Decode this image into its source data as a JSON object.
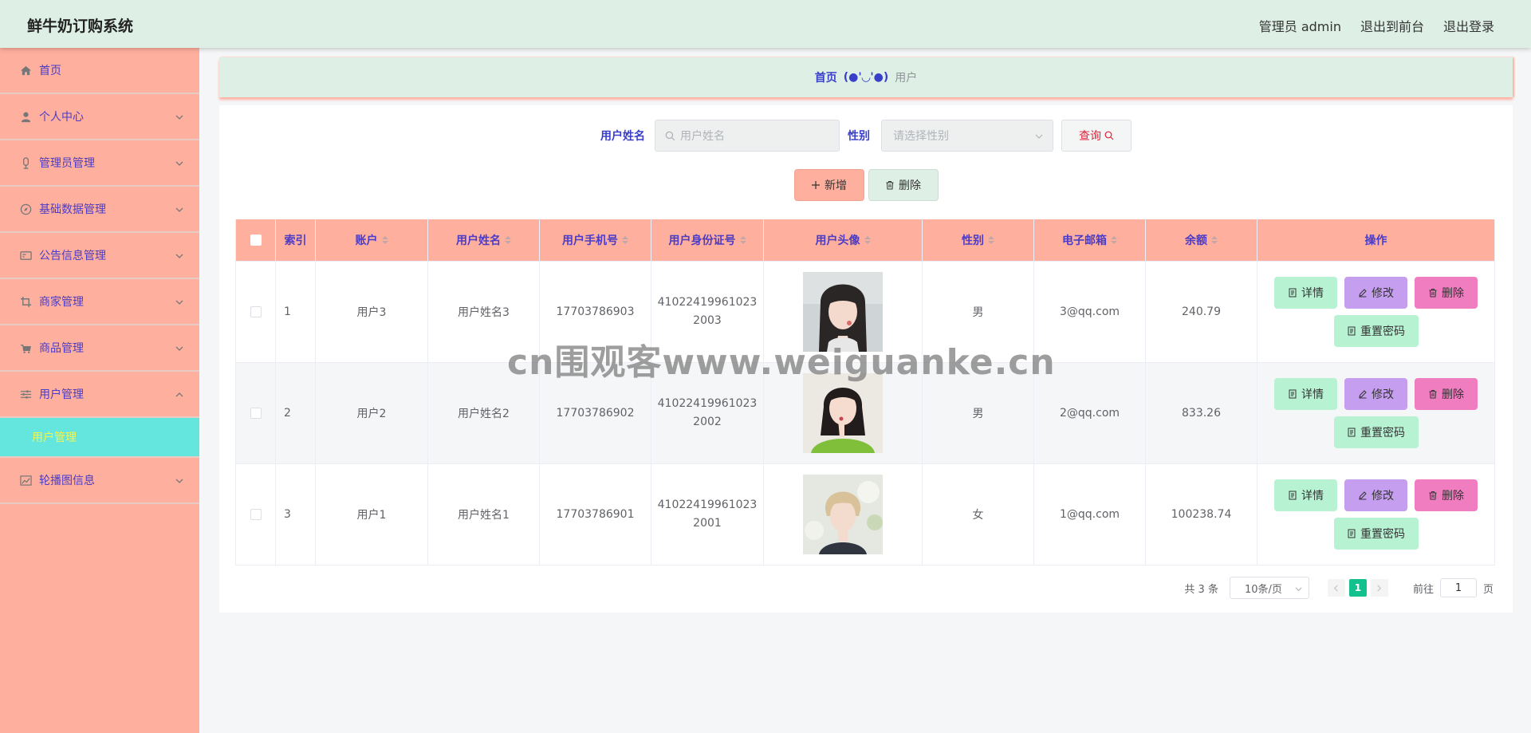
{
  "app": {
    "title": "鲜牛奶订购系统"
  },
  "header": {
    "user_label": "管理员 admin",
    "to_front": "退出到前台",
    "logout": "退出登录"
  },
  "sidebar": {
    "items": [
      {
        "label": "首页",
        "icon": "home-icon"
      },
      {
        "label": "个人中心",
        "icon": "user-icon"
      },
      {
        "label": "管理员管理",
        "icon": "admin-icon"
      },
      {
        "label": "基础数据管理",
        "icon": "compass-icon"
      },
      {
        "label": "公告信息管理",
        "icon": "card-icon"
      },
      {
        "label": "商家管理",
        "icon": "crop-icon"
      },
      {
        "label": "商品管理",
        "icon": "cart-icon"
      },
      {
        "label": "用户管理",
        "icon": "sliders-icon"
      },
      {
        "label": "轮播图信息",
        "icon": "chart-icon"
      }
    ],
    "active_sub": "用户管理"
  },
  "breadcrumb": {
    "home": "首页",
    "sep": "(●'◡'●)",
    "current": "用户"
  },
  "search": {
    "name_label": "用户姓名",
    "name_placeholder": "用户姓名",
    "sex_label": "性别",
    "sex_placeholder": "请选择性别",
    "query_label": "查询"
  },
  "actions": {
    "add_label": "新增",
    "delete_label": "删除"
  },
  "table": {
    "headers": {
      "index": "索引",
      "account": "账户",
      "name": "用户姓名",
      "phone": "用户手机号",
      "id_card": "用户身份证号",
      "photo": "用户头像",
      "sex": "性别",
      "email": "电子邮箱",
      "balance": "余额",
      "ops": "操作"
    },
    "rows": [
      {
        "index": "1",
        "account": "用户3",
        "name": "用户姓名3",
        "phone": "17703786903",
        "id_card": "410224199610232003",
        "sex": "男",
        "email": "3@qq.com",
        "balance": "240.79"
      },
      {
        "index": "2",
        "account": "用户2",
        "name": "用户姓名2",
        "phone": "17703786902",
        "id_card": "410224199610232002",
        "sex": "男",
        "email": "2@qq.com",
        "balance": "833.26"
      },
      {
        "index": "3",
        "account": "用户1",
        "name": "用户姓名1",
        "phone": "17703786901",
        "id_card": "410224199610232001",
        "sex": "女",
        "email": "1@qq.com",
        "balance": "100238.74"
      }
    ],
    "ops": {
      "detail": "详情",
      "edit": "修改",
      "delete": "删除",
      "reset": "重置密码"
    }
  },
  "pagination": {
    "total": "共 3 条",
    "page_size": "10条/页",
    "current": "1",
    "goto_label": "前往",
    "goto_value": "1",
    "page_unit": "页"
  },
  "watermark": "cn围观客www.weiguanke.cn",
  "colors": {
    "sidebar": "#ffaf9e",
    "header": "#deefe6",
    "accent_text": "#4a3cc7",
    "active_sub_bg": "#64e6df",
    "pager_active": "#13c18f"
  }
}
